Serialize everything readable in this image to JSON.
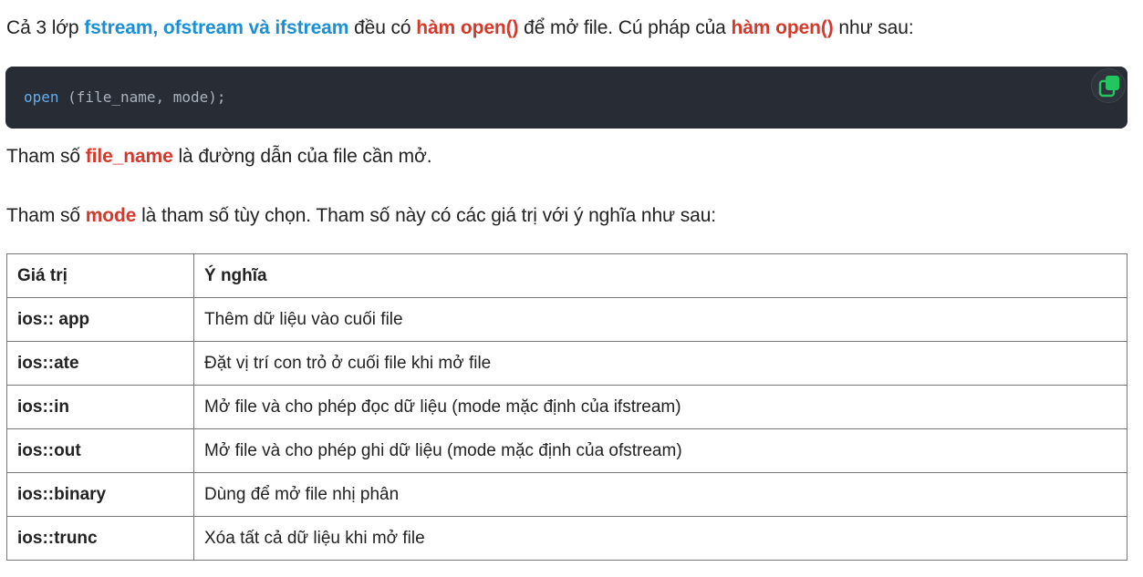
{
  "intro": {
    "pre": "Cả 3 lớp ",
    "classes": "fstream, ofstream và ifstream",
    "mid1": " đều có ",
    "func1": "hàm open()",
    "mid2": " để mở file. Cú pháp của ",
    "func2": "hàm open()",
    "post": " như sau:"
  },
  "code": {
    "fn": "open",
    "args": " (file_name, mode);",
    "copy_icon": "copy-icon"
  },
  "param1": {
    "pre": "Tham số ",
    "name": "file_name",
    "post": " là đường dẫn của file cần mở."
  },
  "param2": {
    "pre": "Tham số ",
    "name": "mode",
    "post": " là tham số tùy chọn. Tham số này có các giá trị với ý nghĩa như sau:"
  },
  "table": {
    "headers": [
      "Giá trị",
      "Ý nghĩa"
    ],
    "rows": [
      {
        "value": "ios:: app",
        "meaning": "Thêm dữ liệu vào cuối file"
      },
      {
        "value": "ios::ate",
        "meaning": "Đặt vị trí con trỏ ở cuối file khi mở file"
      },
      {
        "value": "ios::in",
        "meaning": "Mở file và cho phép đọc dữ liệu (mode mặc định của ifstream)"
      },
      {
        "value": "ios::out",
        "meaning": "Mở file và cho phép ghi dữ liệu (mode mặc định của ofstream)"
      },
      {
        "value": "ios::binary",
        "meaning": "Dùng để mở file nhị phân"
      },
      {
        "value": "ios::trunc",
        "meaning": "Xóa tất cả dữ liệu khi mở file"
      }
    ]
  },
  "colors": {
    "highlight_blue": "#1a8fd6",
    "highlight_red": "#d33a2c",
    "code_bg": "#282c34",
    "copy_icon_green": "#22c55e"
  }
}
